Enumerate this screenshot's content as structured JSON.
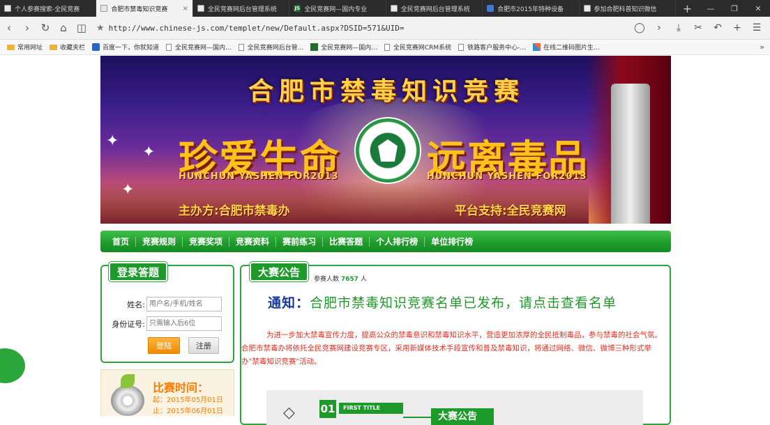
{
  "browser": {
    "tabs": [
      {
        "title": "个人参赛搜索-全民竞赛",
        "icon": "doc",
        "active": false
      },
      {
        "title": "合肥市禁毒知识竞赛",
        "icon": "doc",
        "active": true,
        "close": "×"
      },
      {
        "title": "全民竞赛网后台管理系统",
        "icon": "doc",
        "active": false
      },
      {
        "title": "全民竞赛网—国内专业",
        "icon": "js",
        "active": false
      },
      {
        "title": "全民竞赛网后台管理系统",
        "icon": "doc",
        "active": false
      },
      {
        "title": "合肥市2015年特种设备",
        "icon": "cal",
        "active": false
      },
      {
        "title": "参加合肥科普知识微信",
        "icon": "doc",
        "active": false
      }
    ],
    "new_tab": "+",
    "window_buttons": [
      "—",
      "❐",
      "✕"
    ],
    "url": "http://www.chinese-js.com/templet/new/Default.aspx?DSID=571&UID=",
    "bookmarks": [
      {
        "label": "常用网址",
        "icon": "folder"
      },
      {
        "label": "收藏夹栏",
        "icon": "folder"
      },
      {
        "label": "百度一下，你就知道",
        "icon": "baidu"
      },
      {
        "label": "全民竞赛网—国内...",
        "icon": "page"
      },
      {
        "label": "全民竞赛网后台管...",
        "icon": "page"
      },
      {
        "label": "全民竞赛网—国内...",
        "icon": "js"
      },
      {
        "label": "全民竞赛网CRM系统",
        "icon": "page"
      },
      {
        "label": "铁路客户服务中心-...",
        "icon": "page"
      },
      {
        "label": "在线二维码图片生...",
        "icon": "qr"
      }
    ],
    "bookmarks_more": "»"
  },
  "banner": {
    "title": "合肥市禁毒知识竞赛",
    "slogan_left": "珍爱生命",
    "slogan_right": "远离毒品",
    "en_left": "HUNCHUN YASHEN FOR2013",
    "en_right": "HUNCHUN YASHEN FOR2013",
    "sponsor": "主办方:合肥市禁毒办",
    "support": "平台支持:全民竞赛网"
  },
  "nav": [
    "首页",
    "竞赛规则",
    "竞赛奖项",
    "竞赛资料",
    "赛前练习",
    "比赛答题",
    "个人排行榜",
    "单位排行榜"
  ],
  "login": {
    "title": "登录答题",
    "name_label": "姓名:",
    "name_placeholder": "用户名/手机/姓名",
    "id_label": "身份证号:",
    "id_placeholder": "只需输入后6位",
    "login_btn": "登陆",
    "register_btn": "注册"
  },
  "time": {
    "title": "比赛时间：",
    "start": "起：2015年05月01日",
    "end": "止：2015年06月01日"
  },
  "notice": {
    "title": "大赛公告",
    "count_prefix": "参赛人数",
    "count": "7657",
    "count_suffix": "人",
    "headline_key": "通知：",
    "headline_rest": "合肥市禁毒知识竞赛名单已发布，请点击查看名单",
    "body": "为进一步加大禁毒宣传力度，提高公众的禁毒意识和禁毒知识水平，营造更加浓厚的全民抵制毒品，参与禁毒的社会气氛。合肥市禁毒办将依托全民竞赛网建设竞赛专区，采用新媒体技术手段宣传和普及禁毒知识，将通过网络、微信、微博三种形式举办\"禁毒知识竞赛\"活动。",
    "sub_num": "01",
    "sub_first": "FIRST TITLE",
    "sub_title": "大赛公告"
  }
}
